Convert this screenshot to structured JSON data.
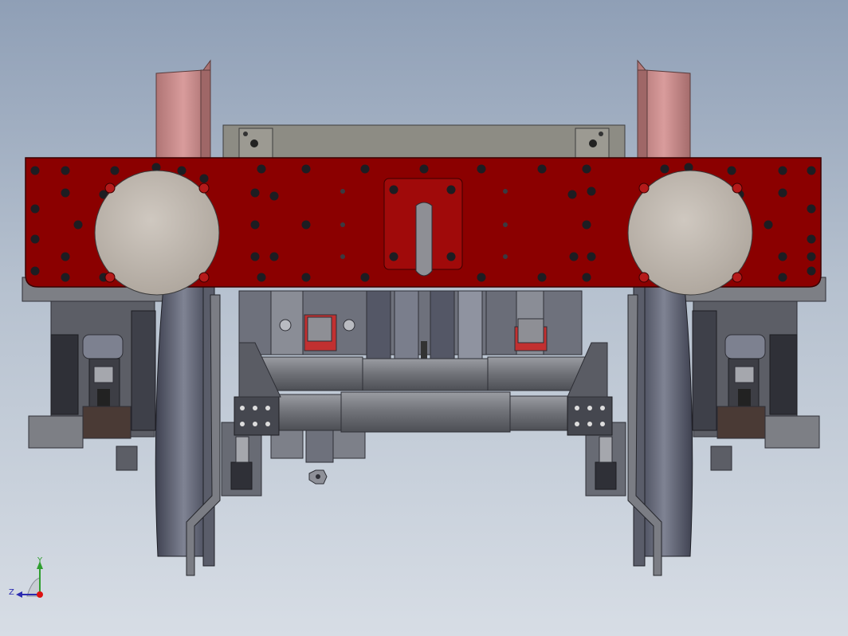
{
  "viewport": {
    "model_description_hidden": "",
    "colors": {
      "background_top": "#8f9fb6",
      "background_bottom": "#d7dde5",
      "buffer_beam": "#8b0000",
      "buffer_head": "#c4bcb4",
      "steel_dark": "#4a4c55",
      "steel_mid": "#7b7d84",
      "frame_pink": "#c98c8c"
    }
  },
  "triad": {
    "axis_y_label": "Y",
    "axis_z_label": "Z",
    "icons": [
      "y-axis-arrow-icon",
      "z-axis-arrow-icon",
      "origin-dot-icon"
    ]
  }
}
